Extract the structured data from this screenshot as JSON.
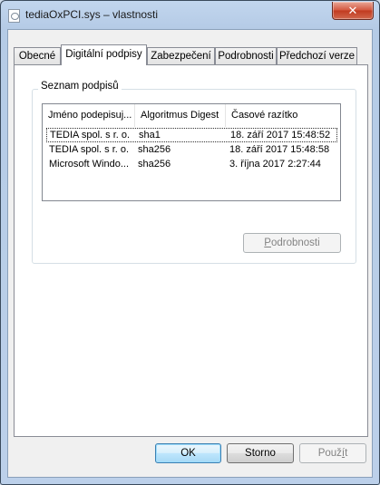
{
  "window": {
    "title": "tediaOxPCI.sys – vlastnosti",
    "close_glyph": "✕"
  },
  "tabs": [
    {
      "label": "Obecné"
    },
    {
      "label": "Digitální podpisy"
    },
    {
      "label": "Zabezpečení"
    },
    {
      "label": "Podrobnosti"
    },
    {
      "label": "Předchozí verze"
    }
  ],
  "active_tab": "Digitální podpisy",
  "signature_list": {
    "group_label": "Seznam podpisů",
    "columns": [
      "Jméno podepisuj...",
      "Algoritmus Digest",
      "Časové razítko"
    ],
    "rows": [
      [
        "TEDIA spol. s r. o.",
        "sha1",
        "18. září 2017 15:48:52"
      ],
      [
        "TEDIA spol. s r. o.",
        "sha256",
        "18. září 2017 15:48:58"
      ],
      [
        "Microsoft Windo...",
        "sha256",
        "3. října 2017 2:27:44"
      ]
    ]
  },
  "details_button": {
    "label_prefix": "",
    "label_accel": "P",
    "label_rest": "odrobnosti"
  },
  "footer": {
    "ok_label": "OK",
    "cancel_label": "Storno",
    "apply_prefix": "Použ",
    "apply_accel": "í",
    "apply_rest": "t"
  }
}
